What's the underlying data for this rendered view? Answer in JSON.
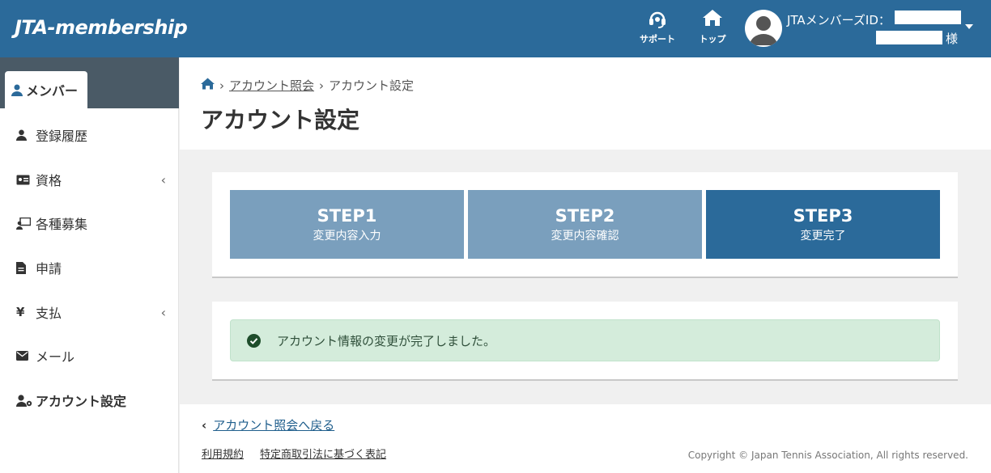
{
  "header": {
    "logo": "JTA-membership",
    "support_label": "サポート",
    "top_label": "トップ",
    "user_id_label": "JTAメンバーズID：",
    "honorific": "様"
  },
  "sidebar": {
    "section_tab": "メンバー",
    "items": [
      {
        "label": "登録履歴",
        "icon": "user-icon"
      },
      {
        "label": "資格",
        "icon": "id-card-icon"
      },
      {
        "label": "各種募集",
        "icon": "chalkboard-user-icon"
      },
      {
        "label": "申請",
        "icon": "document-icon"
      },
      {
        "label": "支払",
        "icon": "yen-icon"
      },
      {
        "label": "メール",
        "icon": "envelope-icon"
      },
      {
        "label": "アカウント設定",
        "icon": "user-gear-icon"
      }
    ]
  },
  "breadcrumb": {
    "link": "アカウント照会",
    "current": "アカウント設定"
  },
  "page_title": "アカウント設定",
  "steps": [
    {
      "num": "STEP1",
      "label": "変更内容入力"
    },
    {
      "num": "STEP2",
      "label": "変更内容確認"
    },
    {
      "num": "STEP3",
      "label": "変更完了"
    }
  ],
  "alert": {
    "message": "アカウント情報の変更が完了しました。"
  },
  "footer": {
    "back_link": "アカウント照会へ戻る",
    "terms": "利用規約",
    "commerce": "特定商取引法に基づく表記",
    "copyright": "Copyright © Japan Tennis Association, All rights reserved."
  },
  "colors": {
    "header_bg": "#2b6a9a",
    "step_inactive": "#7a9fbd",
    "step_active": "#2b6a9a",
    "alert_bg": "#d4ecdb"
  }
}
